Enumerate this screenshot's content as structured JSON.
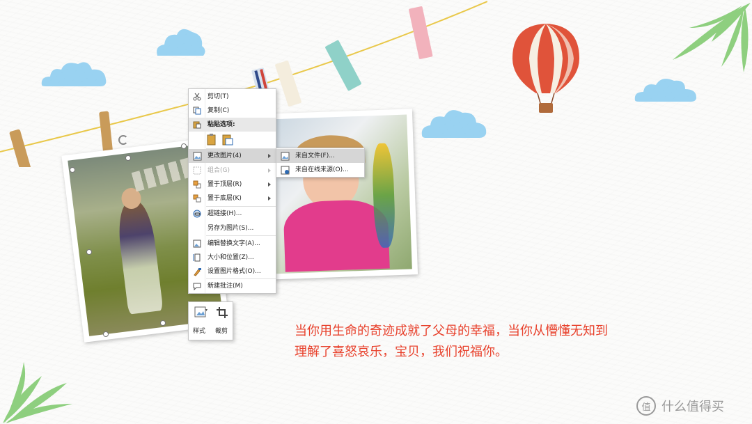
{
  "context_menu": {
    "items": [
      {
        "label": "剪切(T)",
        "icon": "scissors-icon"
      },
      {
        "label": "复制(C)",
        "icon": "copy-icon"
      },
      {
        "label": "粘贴选项:",
        "icon": "paste-icon"
      },
      {
        "label": "更改图片(4)",
        "icon": "change-picture-icon",
        "submenu": true
      },
      {
        "label": "组合(G)",
        "icon": "group-icon",
        "submenu": true,
        "disabled": true
      },
      {
        "label": "置于顶层(R)",
        "icon": "bring-to-front-icon",
        "submenu": true
      },
      {
        "label": "置于底层(K)",
        "icon": "send-to-back-icon",
        "submenu": true
      },
      {
        "label": "超链接(H)...",
        "icon": "hyperlink-icon"
      },
      {
        "label": "另存为图片(S)...",
        "icon": ""
      },
      {
        "label": "编辑替换文字(A)...",
        "icon": "alt-text-icon"
      },
      {
        "label": "大小和位置(Z)...",
        "icon": "size-position-icon"
      },
      {
        "label": "设置图片格式(O)...",
        "icon": "format-picture-icon"
      },
      {
        "label": "新建批注(M)",
        "icon": "new-comment-icon"
      }
    ]
  },
  "submenu": {
    "items": [
      {
        "label": "来自文件(F)...",
        "icon": "from-file-icon"
      },
      {
        "label": "来自在线来源(O)...",
        "icon": "from-online-icon"
      }
    ]
  },
  "mini_toolbar": {
    "style_label": "样式",
    "crop_label": "裁剪"
  },
  "caption": {
    "line1": "当你用生命的奇迹成就了父母的幸福，当你从懵懂无知到",
    "line2": "理解了喜怒哀乐，宝贝，我们祝福你。"
  },
  "watermark": {
    "icon_text": "值",
    "text": "什么值得买"
  },
  "colors": {
    "caption": "#e8412c",
    "menu_highlight": "#d6d6d6",
    "accent_icon": "#2f6bb3"
  }
}
